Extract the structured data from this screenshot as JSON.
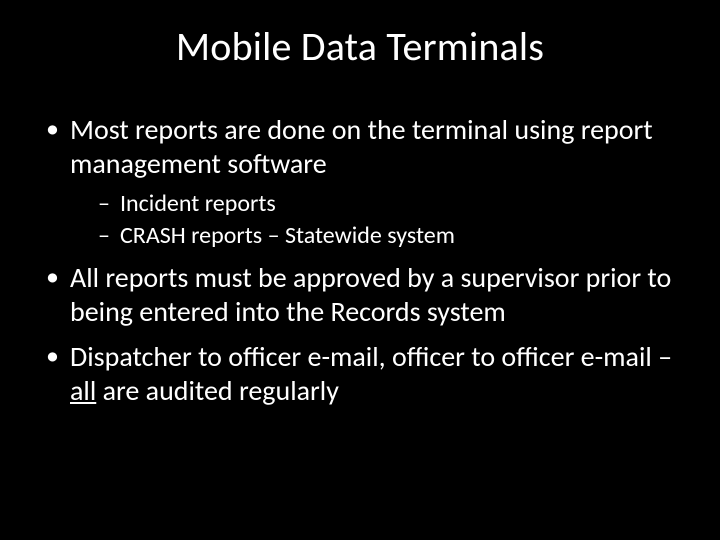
{
  "title": "Mobile Data Terminals",
  "bullets": {
    "b1": "Most reports are done on the terminal using report management software",
    "b1_sub": {
      "s1": "Incident reports",
      "s2": "CRASH reports – Statewide system"
    },
    "b2": "All reports must be approved by a supervisor prior to being entered into the Records system",
    "b3_pre": "Dispatcher to officer e-mail, officer to officer e-mail – ",
    "b3_underline": "all",
    "b3_post": " are audited regularly"
  }
}
